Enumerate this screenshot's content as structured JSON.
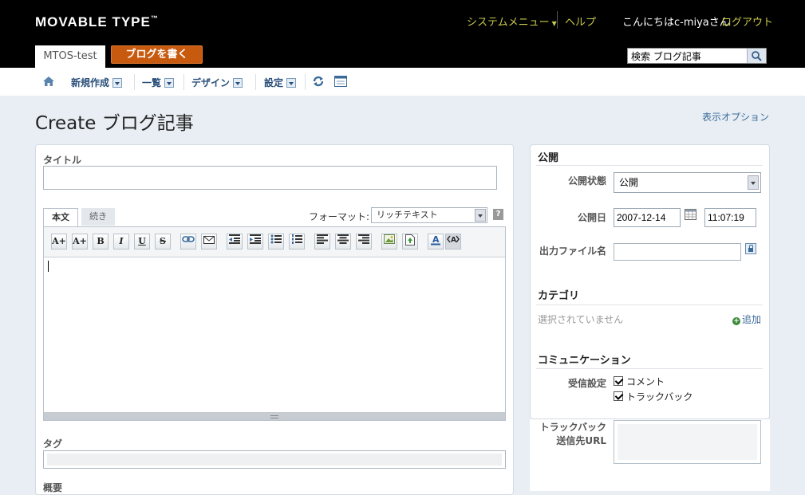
{
  "header": {
    "logo_text": "MOVABLE TYPE",
    "logo_tm": "™",
    "system_menu": "システムメニュー",
    "help": "ヘルプ",
    "greeting": "こんにちはc-miyaさん",
    "logout": "ログアウト",
    "blog_name": "MTOS-test",
    "write_button": "ブログを書く",
    "search_value": "検索 ブログ記事"
  },
  "nav": {
    "items": [
      {
        "label": "新規作成"
      },
      {
        "label": "一覧"
      },
      {
        "label": "デザイン"
      },
      {
        "label": "設定"
      }
    ]
  },
  "page": {
    "title": "Create ブログ記事",
    "display_options": "表示オプション"
  },
  "main": {
    "title_label": "タイトル",
    "title_value": "",
    "tab_body": "本文",
    "tab_more": "続き",
    "format_label": "フォーマット:",
    "format_value": "リッチテキスト",
    "help_mark": "?",
    "tags_label": "タグ",
    "excerpt_label": "概要",
    "toolbar": [
      "A+",
      "A+",
      "B",
      "I",
      "U",
      "S"
    ]
  },
  "sidebar": {
    "publish_head": "公開",
    "status_label": "公開状態",
    "status_value": "公開",
    "date_label": "公開日",
    "date_value": "2007-12-14",
    "time_value": "11:07:19",
    "filename_label": "出力ファイル名",
    "filename_value": "",
    "category_head": "カテゴリ",
    "category_none": "選択されていません",
    "category_add": "追加",
    "comm_head": "コミュニケーション",
    "accept_label": "受信設定",
    "accept_comment": "コメント",
    "accept_trackback": "トラックバック",
    "tb_label_1": "トラックバック",
    "tb_label_2": "送信先URL"
  },
  "colors": {
    "accent_link": "#3a6a9a",
    "header_link": "#c8c84a",
    "write_button": "#c85a10"
  }
}
